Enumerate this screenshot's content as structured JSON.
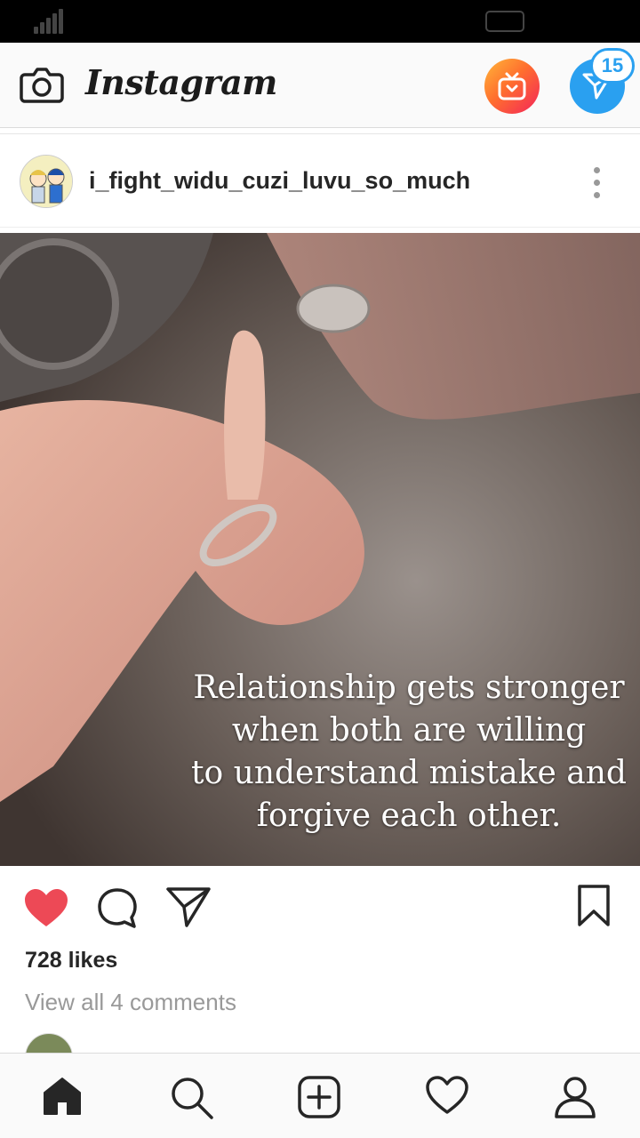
{
  "app": {
    "name": "Instagram"
  },
  "header": {
    "brand": "Instagram",
    "camera_icon": "camera-icon",
    "igtv_icon": "igtv-icon",
    "direct_icon": "direct-message-icon",
    "direct_badge": "15",
    "colors": {
      "direct": "#2aa0f0",
      "igtv_start": "#ffb73a",
      "igtv_end": "#f3245a"
    }
  },
  "post": {
    "username": "i_fight_widu_cuzi_luvu_so_much",
    "more_icon": "more-vertical-icon",
    "image_caption_lines": [
      "Relationship gets stronger",
      "when both are willing",
      "to understand mistake and",
      "forgive each other."
    ],
    "liked": true,
    "like_color": "#ed4956",
    "likes": "728 likes",
    "view_comments": "View all 4 comments"
  },
  "bottom_nav": {
    "items": [
      "home-icon",
      "search-icon",
      "new-post-icon",
      "activity-heart-icon",
      "profile-icon"
    ]
  }
}
